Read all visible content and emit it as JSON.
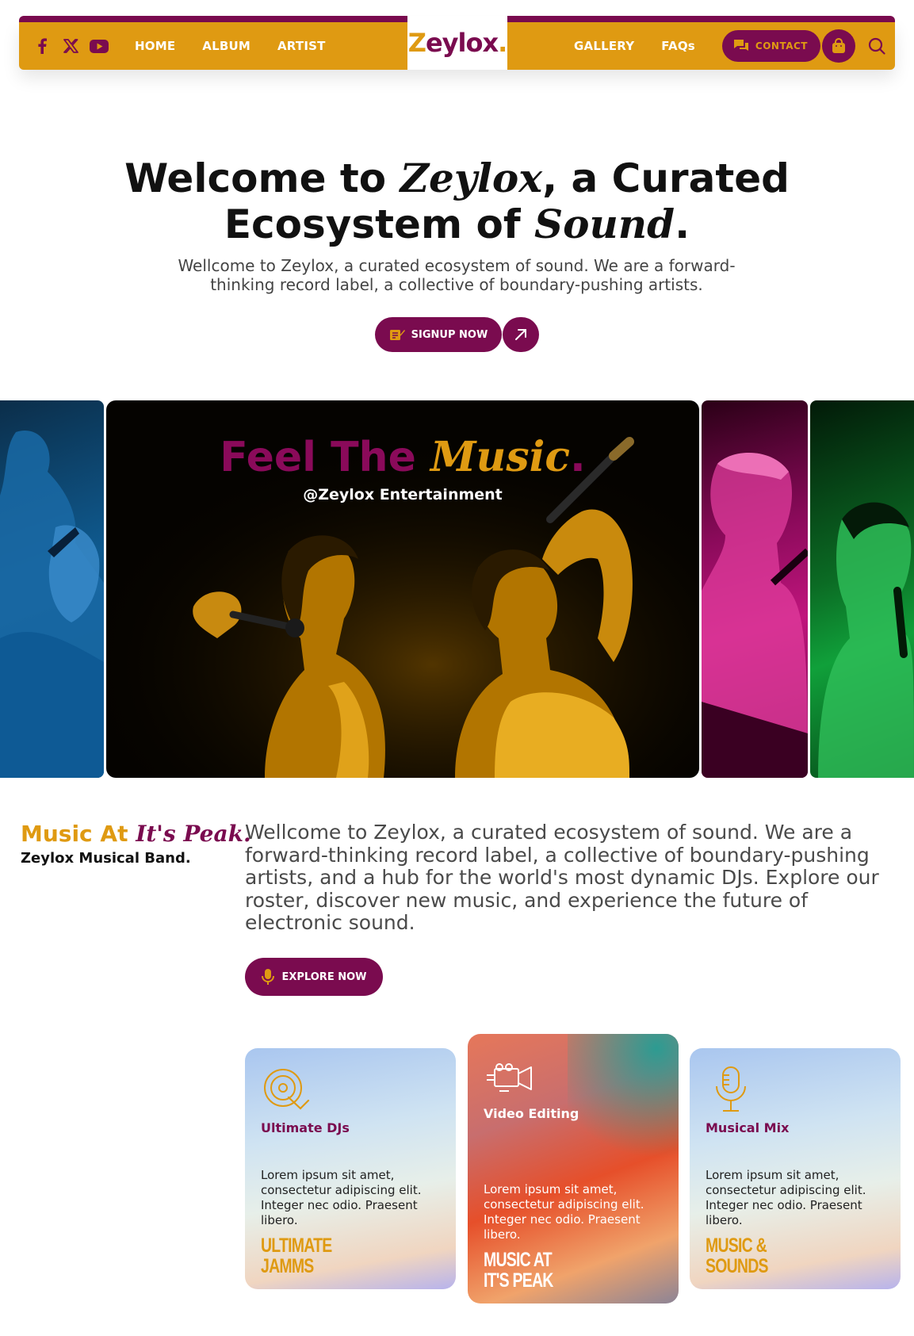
{
  "nav": {
    "links_left": [
      "HOME",
      "ALBUM",
      "ARTIST"
    ],
    "links_right": [
      "GALLERY",
      "FAQs"
    ],
    "logo": {
      "main": "Zeylox",
      "dot": "."
    },
    "contact_label": "CONTACT",
    "social_icons": [
      "facebook-icon",
      "x-twitter-icon",
      "youtube-icon"
    ],
    "colors": {
      "primary": "#7a0b4f",
      "accent": "#df9a12"
    }
  },
  "hero": {
    "title_a": "Welcome to ",
    "title_b": "Zeylox",
    "title_c": ", a Curated",
    "title_d": "Ecosystem of ",
    "title_e": "Sound",
    "title_f": ".",
    "subtitle": "Wellcome to Zeylox, a curated ecosystem of sound. We are a forward-thinking record label, a collective of boundary-pushing artists.",
    "signup_label": "SIGNUP NOW"
  },
  "gallery": {
    "headline_a": "Feel The ",
    "headline_b": "Music",
    "headline_c": ".",
    "handle": "@Zeylox Entertainment"
  },
  "about": {
    "heading_a": "Music At ",
    "heading_b": "It's Peak.",
    "subheading": "Zeylox Musical Band.",
    "paragraph": "Wellcome to Zeylox, a curated ecosystem of sound. We are a forward-thinking record label, a collective of boundary-pushing artists, and a hub for the world's most dynamic DJs. Explore our roster, discover new music, and experience the future of electronic sound.",
    "explore_label": "EXPLORE NOW"
  },
  "cards": [
    {
      "icon": "turntable-icon",
      "title": "Ultimate DJs",
      "text": "Lorem ipsum sit amet, consectetur adipiscing elit. Integer nec odio. Praesent libero.",
      "tag_1": "ULTIMATE",
      "tag_2": "JAMMS"
    },
    {
      "icon": "video-camera-icon",
      "title": "Video Editing",
      "text": "Lorem ipsum sit amet, consectetur adipiscing elit. Integer nec odio. Praesent libero.",
      "tag_1": "MUSIC AT",
      "tag_2": "IT'S PEAK"
    },
    {
      "icon": "microphone-icon",
      "title": "Musical Mix",
      "text": "Lorem ipsum sit amet, consectetur adipiscing elit. Integer nec odio. Praesent libero.",
      "tag_1": "MUSIC &",
      "tag_2": "SOUNDS"
    }
  ]
}
